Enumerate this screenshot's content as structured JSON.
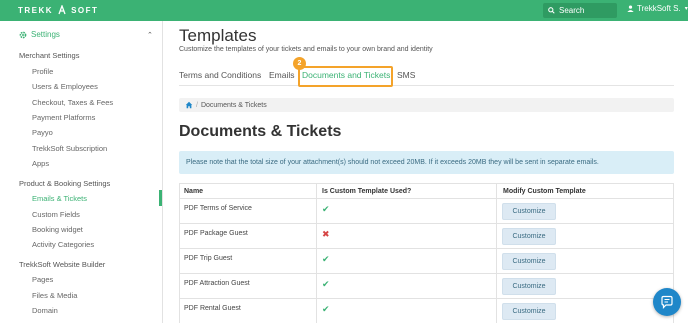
{
  "header": {
    "logo_left": "TREKK",
    "logo_right": "SOFT",
    "search_label": "Search",
    "user_name": "TrekkSoft S."
  },
  "sidebar": {
    "settings_label": "Settings",
    "sections": [
      {
        "label": "Merchant Settings",
        "items": [
          "Profile",
          "Users & Employees",
          "Checkout, Taxes & Fees",
          "Payment Platforms",
          "Payyo",
          "TrekkSoft Subscription",
          "Apps"
        ]
      },
      {
        "label": "Product & Booking Settings",
        "items": [
          "Emails & Tickets",
          "Custom Fields",
          "Booking widget",
          "Activity Categories"
        ]
      },
      {
        "label": "TrekkSoft Website Builder",
        "items": [
          "Pages",
          "Files & Media",
          "Domain"
        ]
      }
    ],
    "active_item": "Emails & Tickets"
  },
  "main": {
    "title": "Templates",
    "subtitle": "Customize the templates of your tickets and emails to your own brand and identity",
    "tabs": [
      "Terms and Conditions",
      "Emails",
      "Documents and Tickets",
      "SMS"
    ],
    "active_tab": "Documents and Tickets",
    "step_number": "2",
    "breadcrumb": "Documents & Tickets",
    "section_title": "Documents & Tickets",
    "alert": "Please note that the total size of your attachment(s) should not exceed 20MB. If it exceeds 20MB they will be sent in separate emails.",
    "table": {
      "headers": [
        "Name",
        "Is Custom Template Used?",
        "Modify Custom Template"
      ],
      "rows": [
        {
          "name": "PDF Terms of Service",
          "used": "✔",
          "action": "Customize"
        },
        {
          "name": "PDF Package Guest",
          "used": "✖",
          "action": "Customize"
        },
        {
          "name": "PDF Trip Guest",
          "used": "✔",
          "action": "Customize"
        },
        {
          "name": "PDF Attraction Guest",
          "used": "✔",
          "action": "Customize"
        },
        {
          "name": "PDF Rental Guest",
          "used": "✔",
          "action": "Customize"
        }
      ]
    }
  },
  "colors": {
    "brand_green": "#3bb274",
    "highlight_orange": "#f4a32a",
    "alert_bg": "#d9eef7",
    "chat_blue": "#1f87c9"
  }
}
